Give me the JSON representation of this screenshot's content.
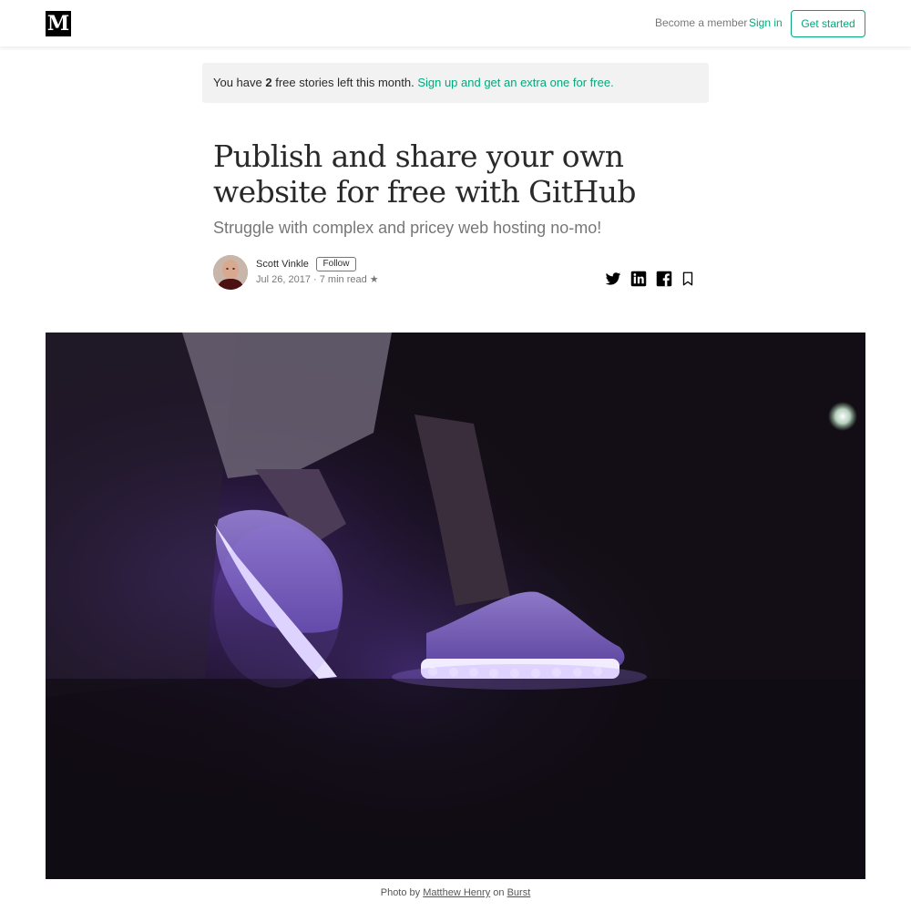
{
  "header": {
    "logo_letter": "M",
    "become_member": "Become a member",
    "sign_in": "Sign in",
    "get_started": "Get started"
  },
  "meter": {
    "prefix": "You have",
    "count": "2",
    "middle": "free stories left this month.",
    "signup_link": "Sign up and get an extra one for free."
  },
  "article": {
    "title": "Publish and share your own website for free with GitHub",
    "subtitle": "Struggle with complex and pricey web hosting no-mo!",
    "author": {
      "name": "Scott Vinkle",
      "follow_label": "Follow",
      "date": "Jul 26, 2017",
      "separator": "·",
      "read_time": "7 min read",
      "star": "★"
    },
    "share_icons": [
      "twitter-icon",
      "linkedin-icon",
      "facebook-icon",
      "bookmark-icon"
    ]
  },
  "hero_caption": {
    "prefix": "Photo by",
    "photographer": "Matthew Henry",
    "middle": "on",
    "source": "Burst"
  },
  "colors": {
    "accent": "#03a87c",
    "meter_bg": "#f2f2f2",
    "hero_glow": "#8a5cf0"
  }
}
